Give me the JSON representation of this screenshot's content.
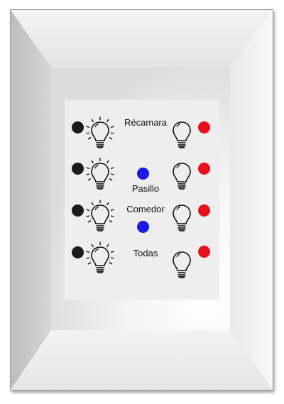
{
  "colors": {
    "left_indicator": "#1a1a1a",
    "right_indicator": "#e8101a",
    "center_indicator": "#1a1ae6",
    "panel_background": "#eeeeee"
  },
  "rows": [
    {
      "label": "Récamara",
      "left_icon": "bulb-on-icon",
      "right_icon": "bulb-off-icon"
    },
    {
      "label": "Pasillo",
      "left_icon": "bulb-on-icon",
      "right_icon": "bulb-off-icon"
    },
    {
      "label": "Comedor",
      "left_icon": "bulb-on-icon",
      "right_icon": "bulb-off-icon"
    },
    {
      "label": "Todas",
      "left_icon": "bulb-on-icon",
      "right_icon": "bulb-off-icon"
    }
  ]
}
